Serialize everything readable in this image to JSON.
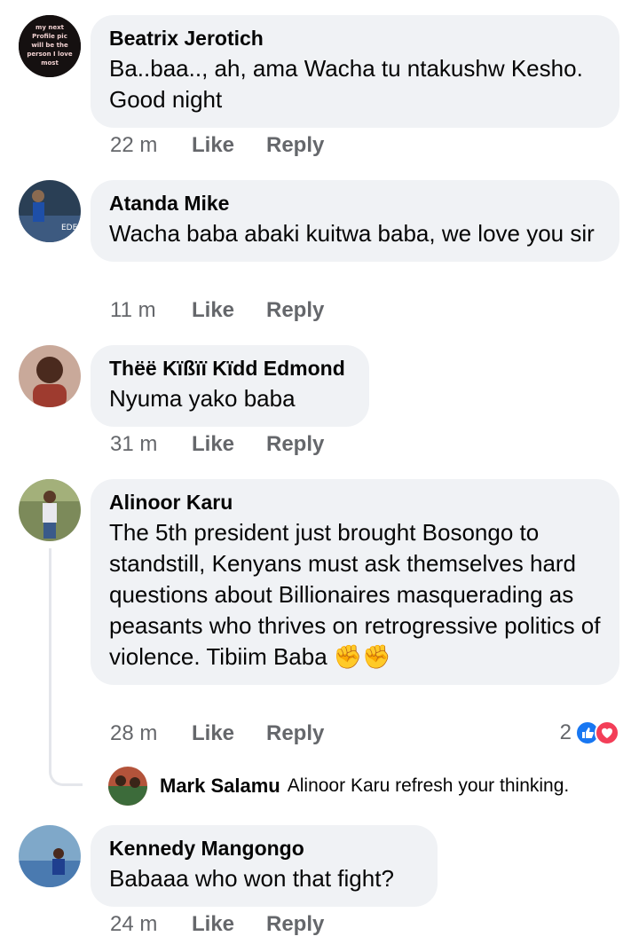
{
  "comments": [
    {
      "author": "Beatrix Jerotich",
      "text": "Ba..baa.., ah, ama Wacha tu ntakushw Kesho. Good night",
      "time": "22 m",
      "like": "Like",
      "reply": "Reply",
      "avatar_text": "my next Profile pic will be the person I love most"
    },
    {
      "author": "Atanda Mike",
      "text": "Wacha baba abaki kuitwa baba, we love you sir",
      "time": "11 m",
      "like": "Like",
      "reply": "Reply",
      "avatar_text": "EDEN"
    },
    {
      "author": "Thëë Kïßïï Kïdd Edmond",
      "text": "Nyuma yako baba",
      "time": "31 m",
      "like": "Like",
      "reply": "Reply"
    },
    {
      "author": "Alinoor Karu",
      "text": "The 5th president just brought Bosongo to standstill, Kenyans must ask themselves hard questions about Billionaires masquerading as peasants who thrives on retrogressive politics of violence. Tibiim Baba ✊✊",
      "time": "28 m",
      "like": "Like",
      "reply": "Reply",
      "reaction_count": "2",
      "reaction_icons": [
        "like-reaction",
        "love-reaction"
      ]
    },
    {
      "author": "Kennedy Mangongo",
      "text": "Babaaa who won that fight?",
      "time": "24 m",
      "like": "Like",
      "reply": "Reply"
    }
  ],
  "reply": {
    "author": "Mark Salamu",
    "text": "Alinoor Karu refresh your thinking."
  },
  "colors": {
    "bubble": "#f0f2f5",
    "meta_text": "#65676b",
    "like_blue": "#1877f2",
    "love_red": "#f33e58"
  }
}
